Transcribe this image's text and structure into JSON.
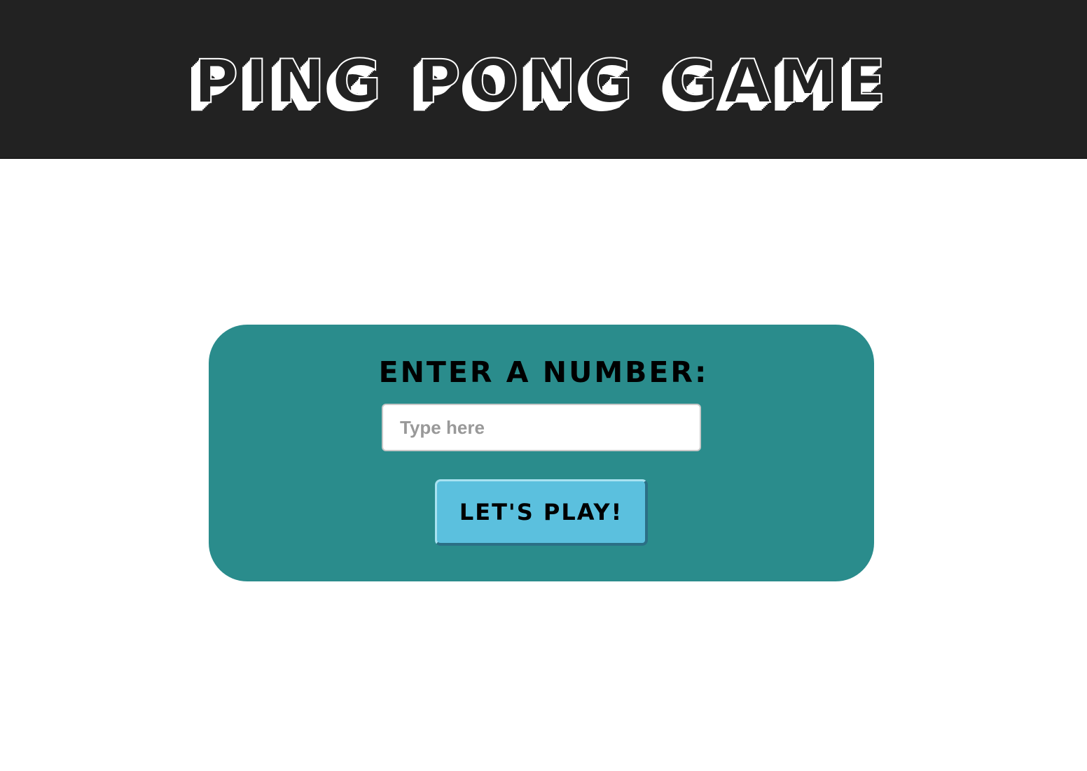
{
  "header": {
    "title": "PING PONG GAME"
  },
  "form": {
    "prompt": "ENTER A NUMBER:",
    "input_placeholder": "Type here",
    "input_value": "",
    "submit_label": "LET'S PLAY!"
  },
  "colors": {
    "header_background": "#222222",
    "card_background": "#2a8c8c",
    "button_background": "#5bc0de",
    "page_background": "#ffffff"
  }
}
